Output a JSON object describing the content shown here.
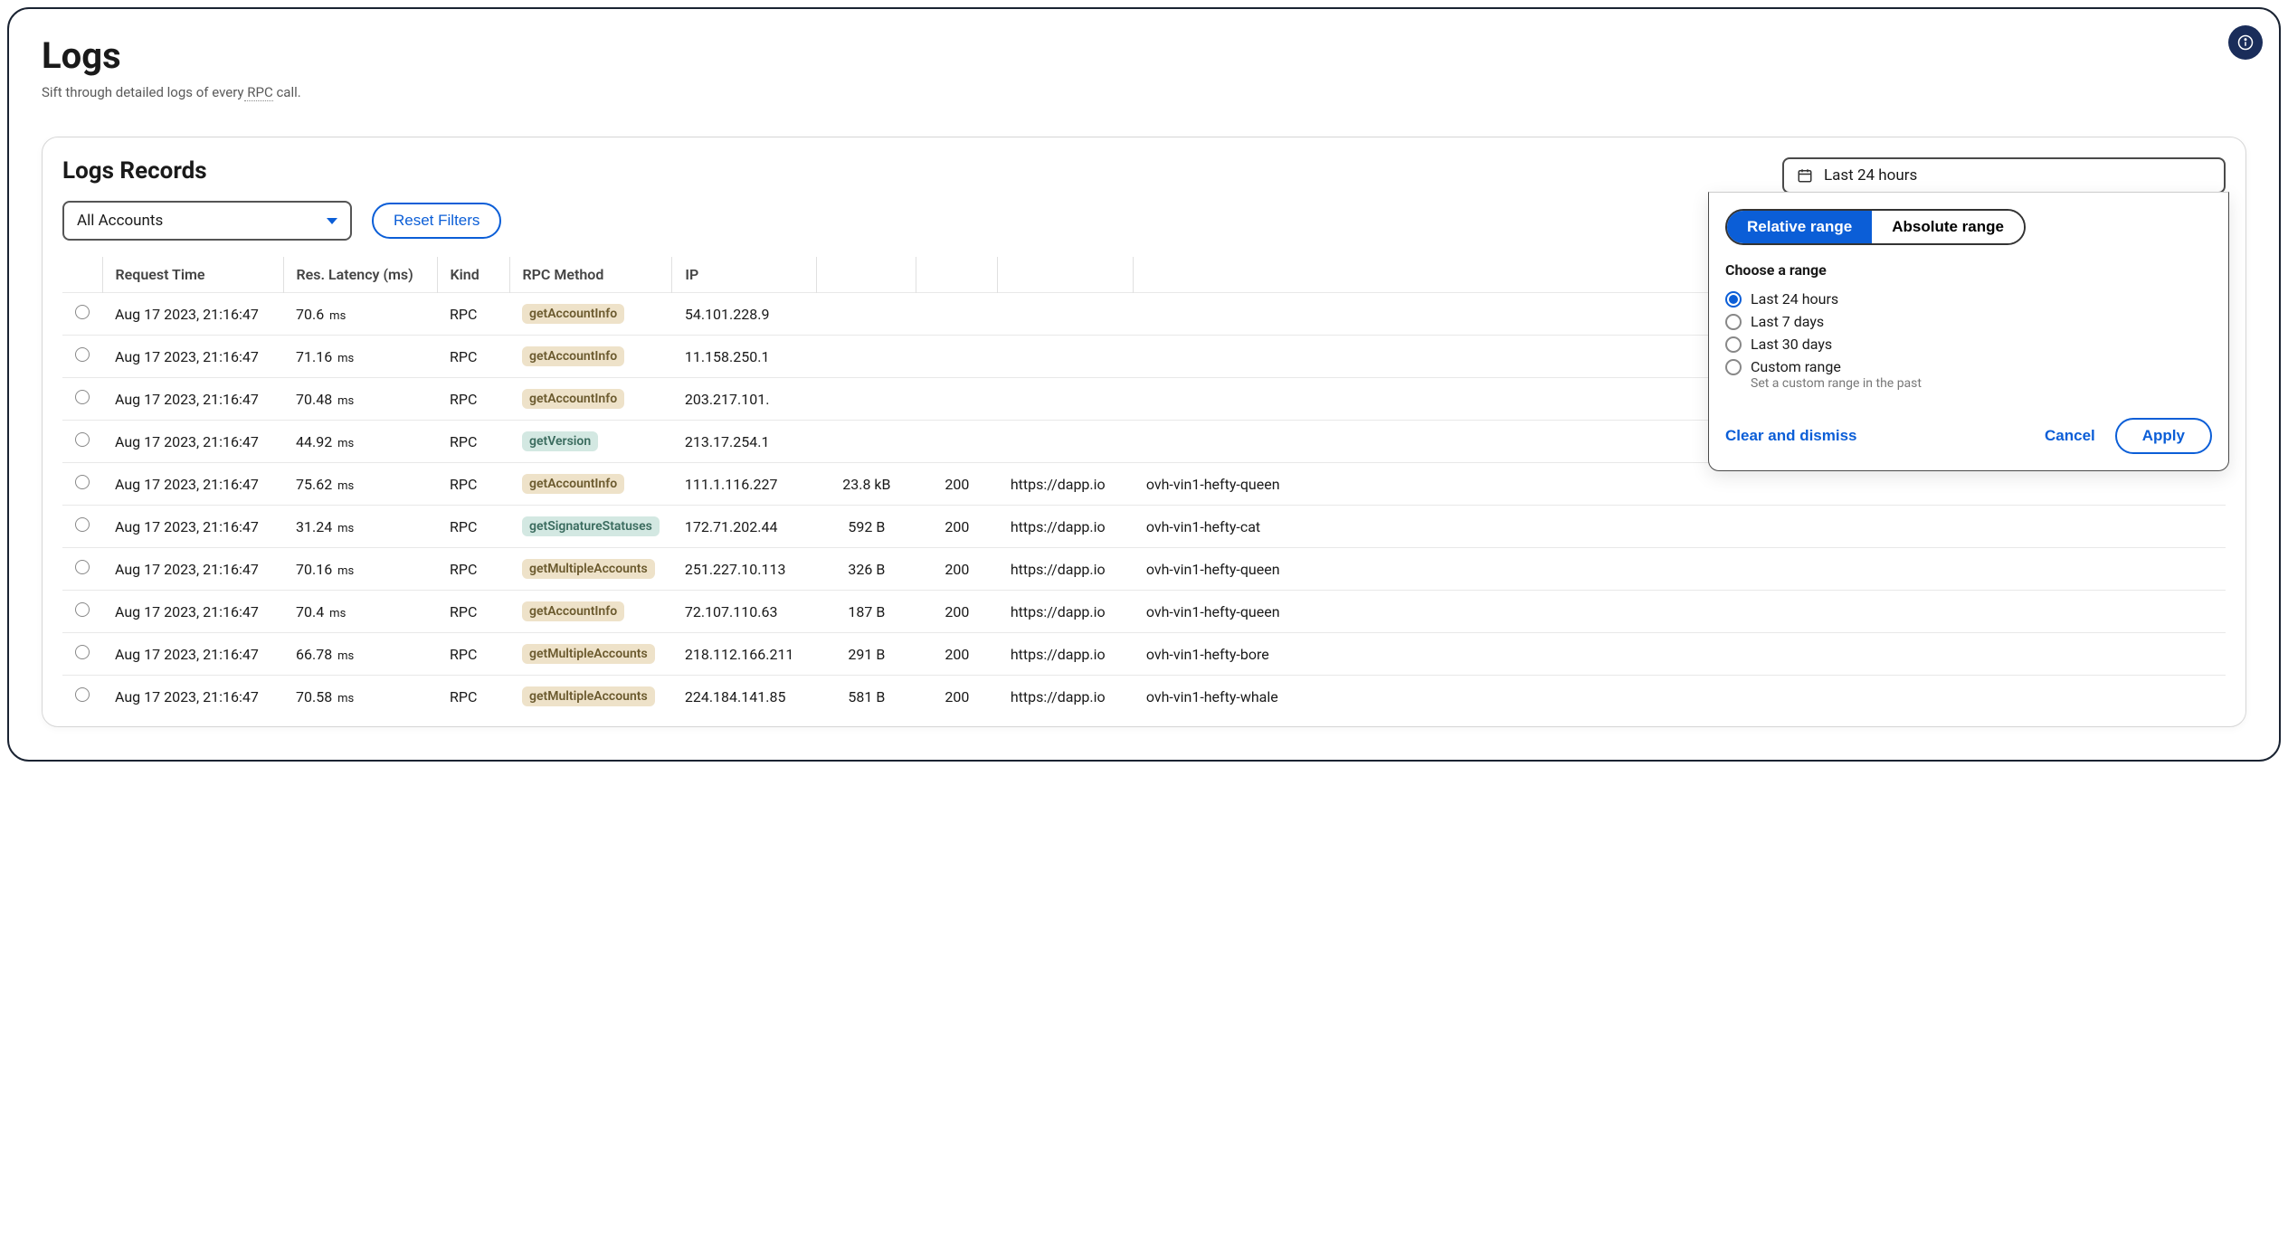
{
  "page": {
    "title": "Logs",
    "subtitle_pre": "Sift through detailed logs of every",
    "subtitle_rpc": " RPC",
    "subtitle_post": " call."
  },
  "card": {
    "title": "Logs Records",
    "account_select": "All Accounts",
    "reset_button": "Reset Filters"
  },
  "date": {
    "trigger": "Last 24 hours",
    "tab_relative": "Relative range",
    "tab_absolute": "Absolute range",
    "choose_label": "Choose a range",
    "options": {
      "last_24": "Last 24 hours",
      "last_7": "Last 7 days",
      "last_30": "Last 30 days",
      "custom": "Custom range",
      "custom_sub": "Set a custom range in the past"
    },
    "clear": "Clear and dismiss",
    "cancel": "Cancel",
    "apply": "Apply"
  },
  "columns": {
    "time": "Request Time",
    "latency": "Res. Latency (ms)",
    "kind": "Kind",
    "method": "RPC Method",
    "ip": "IP",
    "size": "",
    "status": "",
    "origin": "",
    "node": ""
  },
  "rows": [
    {
      "time": "Aug 17 2023, 21:16:47",
      "latency": "70.6",
      "unit": "ms",
      "kind": "RPC",
      "method": "getAccountInfo",
      "ip": "54.101.228.9",
      "size": "",
      "status": "",
      "origin": "",
      "node": ""
    },
    {
      "time": "Aug 17 2023, 21:16:47",
      "latency": "71.16",
      "unit": "ms",
      "kind": "RPC",
      "method": "getAccountInfo",
      "ip": "11.158.250.1",
      "size": "",
      "status": "",
      "origin": "",
      "node": ""
    },
    {
      "time": "Aug 17 2023, 21:16:47",
      "latency": "70.48",
      "unit": "ms",
      "kind": "RPC",
      "method": "getAccountInfo",
      "ip": "203.217.101.",
      "size": "",
      "status": "",
      "origin": "",
      "node": ""
    },
    {
      "time": "Aug 17 2023, 21:16:47",
      "latency": "44.92",
      "unit": "ms",
      "kind": "RPC",
      "method": "getVersion",
      "ip": "213.17.254.1",
      "size": "",
      "status": "",
      "origin": "",
      "node": ""
    },
    {
      "time": "Aug 17 2023, 21:16:47",
      "latency": "75.62",
      "unit": "ms",
      "kind": "RPC",
      "method": "getAccountInfo",
      "ip": "111.1.116.227",
      "size": "23.8 kB",
      "status": "200",
      "origin": "https://dapp.io",
      "node": "ovh-vin1-hefty-queen"
    },
    {
      "time": "Aug 17 2023, 21:16:47",
      "latency": "31.24",
      "unit": "ms",
      "kind": "RPC",
      "method": "getSignatureStatuses",
      "ip": "172.71.202.44",
      "size": "592 B",
      "status": "200",
      "origin": "https://dapp.io",
      "node": "ovh-vin1-hefty-cat"
    },
    {
      "time": "Aug 17 2023, 21:16:47",
      "latency": "70.16",
      "unit": "ms",
      "kind": "RPC",
      "method": "getMultipleAccounts",
      "ip": "251.227.10.113",
      "size": "326 B",
      "status": "200",
      "origin": "https://dapp.io",
      "node": "ovh-vin1-hefty-queen"
    },
    {
      "time": "Aug 17 2023, 21:16:47",
      "latency": "70.4",
      "unit": "ms",
      "kind": "RPC",
      "method": "getAccountInfo",
      "ip": "72.107.110.63",
      "size": "187 B",
      "status": "200",
      "origin": "https://dapp.io",
      "node": "ovh-vin1-hefty-queen"
    },
    {
      "time": "Aug 17 2023, 21:16:47",
      "latency": "66.78",
      "unit": "ms",
      "kind": "RPC",
      "method": "getMultipleAccounts",
      "ip": "218.112.166.211",
      "size": "291 B",
      "status": "200",
      "origin": "https://dapp.io",
      "node": "ovh-vin1-hefty-bore"
    },
    {
      "time": "Aug 17 2023, 21:16:47",
      "latency": "70.58",
      "unit": "ms",
      "kind": "RPC",
      "method": "getMultipleAccounts",
      "ip": "224.184.141.85",
      "size": "581 B",
      "status": "200",
      "origin": "https://dapp.io",
      "node": "ovh-vin1-hefty-whale"
    }
  ]
}
